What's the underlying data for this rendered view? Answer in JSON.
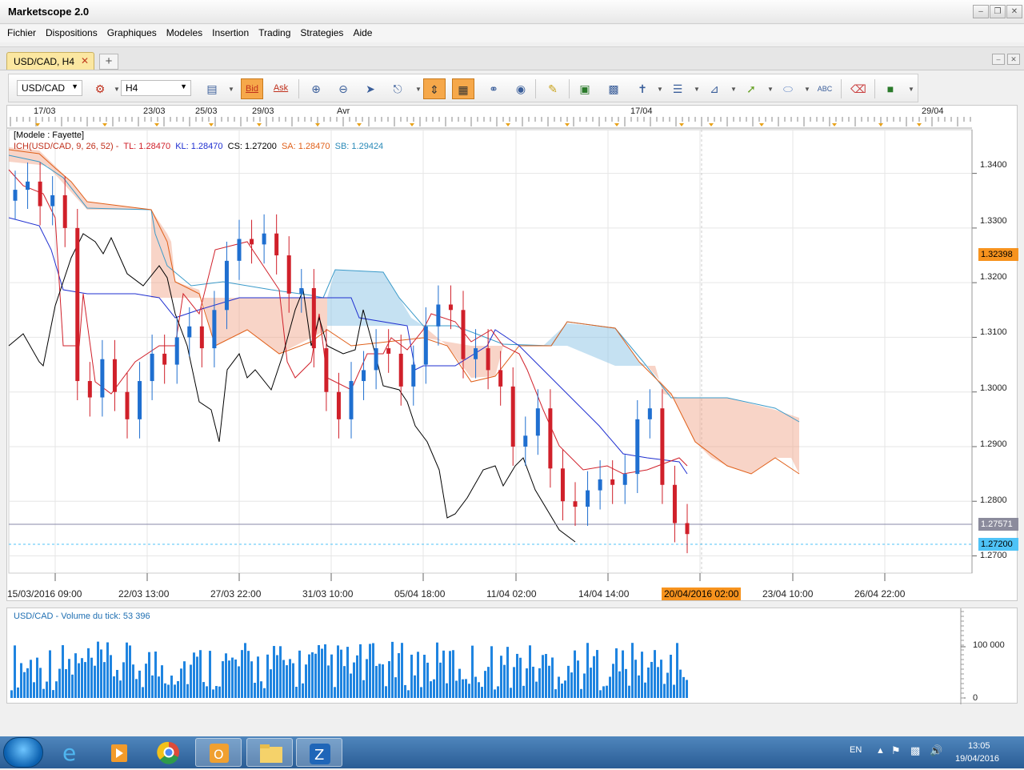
{
  "window": {
    "title": "Marketscope 2.0"
  },
  "menu": [
    "Fichier",
    "Dispositions",
    "Graphiques",
    "Modeles",
    "Insertion",
    "Trading",
    "Strategies",
    "Aide"
  ],
  "tab": {
    "label": "USD/CAD, H4"
  },
  "toolbar": {
    "instrument": "USD/CAD",
    "timeframe": "H4",
    "bid_label": "Bid",
    "ask_label": "Ask"
  },
  "chart": {
    "top_dates": [
      "17/03",
      "23/03",
      "25/03",
      "29/03",
      "Avr",
      "17/04",
      "29/04"
    ],
    "legend_template": "[Modele : Fayette]",
    "indicator_name": "ICH(USD/CAD, 9, 26, 52) -",
    "tl": "TL: 1.28470",
    "kl": "KL: 1.28470",
    "cs": "CS: 1.27200",
    "sa": "SA: 1.28470",
    "sb": "SB: 1.29424",
    "y_ticks": [
      "1.3400",
      "1.3300",
      "1.3200",
      "1.3100",
      "1.3000",
      "1.2900",
      "1.2800",
      "1.2700"
    ],
    "price_marker_orange": "1.32398",
    "price_marker_gray": "1.27571",
    "price_marker_blue": "1.27200",
    "x_labels": [
      "15/03/2016 09:00",
      "22/03 13:00",
      "27/03 22:00",
      "31/03 10:00",
      "05/04 18:00",
      "11/04 02:00",
      "14/04 14:00",
      "23/04 10:00",
      "26/04 22:00"
    ],
    "x_highlight": "20/04/2016 02:00"
  },
  "volume": {
    "title": "USD/CAD - Volume du tick: 53 396",
    "ticks": [
      "100 000",
      "0"
    ]
  },
  "taskbar": {
    "lang": "EN",
    "time": "13:05",
    "date": "19/04/2016"
  },
  "chart_data": {
    "type": "candlestick",
    "instrument": "USD/CAD",
    "timeframe": "H4",
    "ylim": [
      1.267,
      1.348
    ],
    "indicator": {
      "name": "ICH(USD/CAD, 9, 26, 52)",
      "TL": 1.2847,
      "KL": 1.2847,
      "CS": 1.272,
      "SA": 1.2847,
      "SB": 1.29424
    },
    "close_path": [
      1.337,
      1.3385,
      1.334,
      1.336,
      1.33,
      1.302,
      1.299,
      1.306,
      1.3,
      1.295,
      1.302,
      1.307,
      1.305,
      1.31,
      1.312,
      1.308,
      1.315,
      1.324,
      1.328,
      1.327,
      1.329,
      1.325,
      1.318,
      1.319,
      1.308,
      1.3,
      1.295,
      1.302,
      1.304,
      1.308,
      1.307,
      1.301,
      1.305,
      1.312,
      1.316,
      1.315,
      1.306,
      1.308,
      1.304,
      1.301,
      1.29,
      1.292,
      1.297,
      1.286,
      1.28,
      1.279,
      1.282,
      1.284,
      1.283,
      1.285,
      1.295,
      1.297,
      1.283,
      1.276,
      1.274
    ],
    "volume_ticks": [
      0,
      100000
    ]
  }
}
